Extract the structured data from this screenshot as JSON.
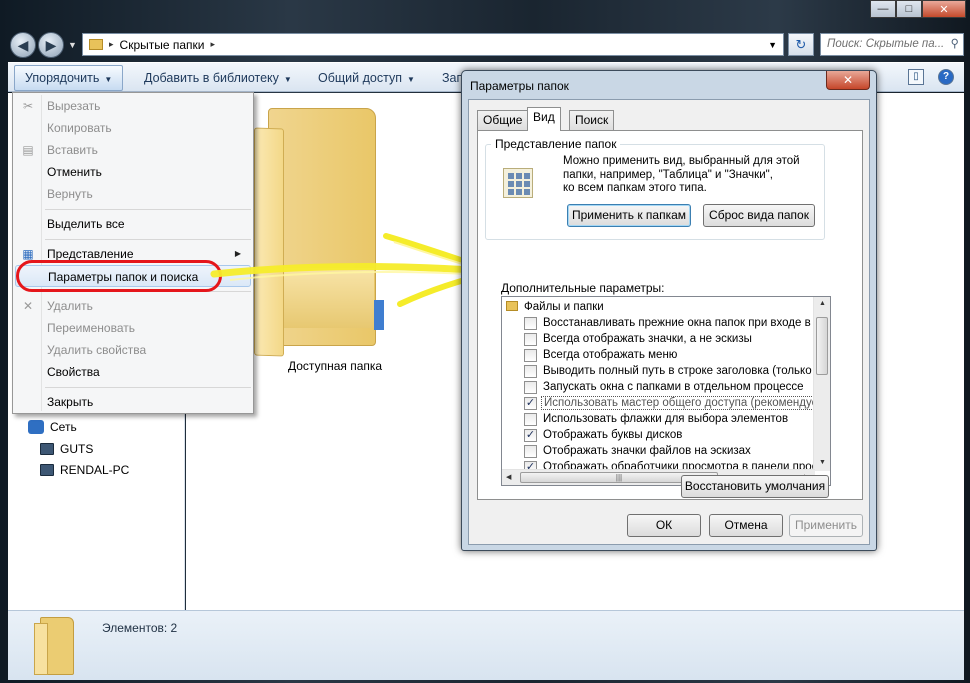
{
  "window": {
    "buttons": {
      "minimize": "—",
      "maximize": "□",
      "close": "✕"
    }
  },
  "address": {
    "path_sep": "▸",
    "path": "Скрытые папки",
    "search_placeholder": "Поиск: Скрытые па..."
  },
  "toolbar": {
    "organize": "Упорядочить",
    "library": "Добавить в библиотеку",
    "share": "Общий доступ",
    "burn": "Запи"
  },
  "menu": {
    "items": [
      {
        "label": "Вырезать",
        "disabled": true,
        "icon": "scissors-icon"
      },
      {
        "label": "Копировать",
        "disabled": true
      },
      {
        "label": "Вставить",
        "disabled": true,
        "icon": "clipboard-icon"
      },
      {
        "label": "Отменить",
        "disabled": false
      },
      {
        "label": "Вернуть",
        "disabled": true
      },
      {
        "label": "Выделить все",
        "disabled": false
      },
      {
        "label": "Представление",
        "disabled": false,
        "icon": "layout-icon",
        "submenu": true
      },
      {
        "label": "Параметры папок и поиска",
        "disabled": false,
        "highlighted": true
      },
      {
        "label": "Удалить",
        "disabled": true,
        "icon": "delete-x-icon"
      },
      {
        "label": "Переименовать",
        "disabled": true
      },
      {
        "label": "Удалить свойства",
        "disabled": true
      },
      {
        "label": "Свойства",
        "disabled": false
      },
      {
        "label": "Закрыть",
        "disabled": false
      }
    ]
  },
  "nav": {
    "network": "Сеть",
    "pcs": [
      "GUTS",
      "RENDAL-PC"
    ]
  },
  "content": {
    "folder_name": "Доступная папка"
  },
  "status": {
    "items_count": "Элементов: 2"
  },
  "dialog": {
    "title": "Параметры папок",
    "close": "✕",
    "tabs": [
      "Общие",
      "Вид",
      "Поиск"
    ],
    "selected_tab": "Вид",
    "group_title": "Представление папок",
    "group_text_lines": [
      "Можно применить вид, выбранный для этой",
      "папки, например, \"Таблица\" и \"Значки\",",
      "ко всем папкам этого типа."
    ],
    "apply_to_folders": "Применить к папкам",
    "reset_folders": "Сброс вида папок",
    "advanced_label": "Дополнительные параметры:",
    "tree_root": "Файлы и папки",
    "options": [
      {
        "label": "Восстанавливать прежние окна папок при входе в с",
        "checked": false
      },
      {
        "label": "Всегда отображать значки, а не эскизы",
        "checked": false
      },
      {
        "label": "Всегда отображать меню",
        "checked": false
      },
      {
        "label": "Выводить полный путь в строке заголовка (только д",
        "checked": false
      },
      {
        "label": "Запускать окна с папками в отдельном процессе",
        "checked": false
      },
      {
        "label": "Использовать мастер общего доступа (рекомендуется)",
        "checked": true,
        "selected": true
      },
      {
        "label": "Использовать флажки для выбора элементов",
        "checked": false
      },
      {
        "label": "Отображать буквы дисков",
        "checked": true
      },
      {
        "label": "Отображать значки файлов на эскизах",
        "checked": false
      },
      {
        "label": "Отображать обработчики просмотра в панели просм",
        "checked": true
      }
    ],
    "restore_defaults": "Восстановить умолчания",
    "ok": "ОК",
    "cancel": "Отмена",
    "apply": "Применить"
  },
  "colors": {
    "highlight_ring": "#e5161b",
    "arrow": "#f5ec2a"
  }
}
